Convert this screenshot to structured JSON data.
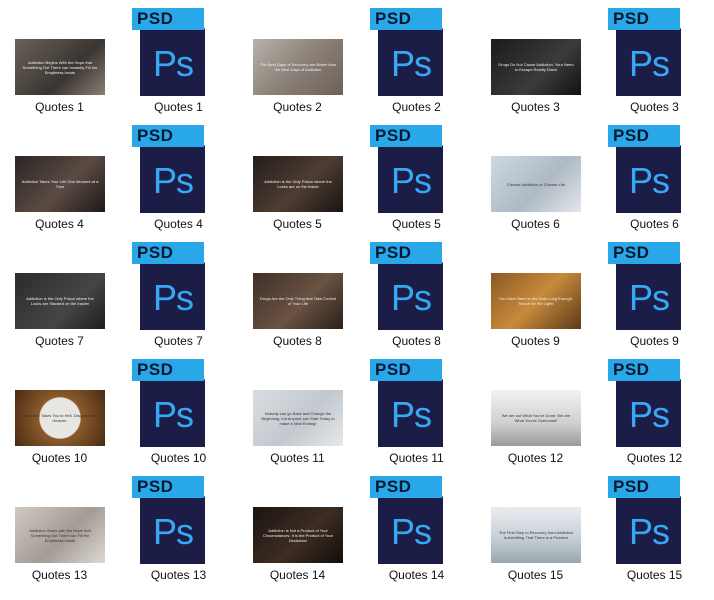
{
  "badge_text": "PSD",
  "ps_text": "Ps",
  "colors": {
    "psd_tag": "#28a8e8",
    "psd_page": "#1c1d47",
    "ps_letters": "#37a9f4"
  },
  "items": [
    {
      "label": "Quotes 1",
      "kind": "image",
      "bg": "linear-gradient(135deg,#6b625b,#3a3531 60%,#8a7f74)",
      "caption": "Addiction Begins With the Hope that Something Out There can Instantly Fill the Emptiness Inside"
    },
    {
      "label": "Quotes 1",
      "kind": "psd"
    },
    {
      "label": "Quotes 2",
      "kind": "image",
      "bg": "linear-gradient(135deg,#b9b2aa,#8b8178 50%,#6d6158)",
      "caption": "The Best Days of Recovery are Better than the Best Days of Addiction"
    },
    {
      "label": "Quotes 2",
      "kind": "psd"
    },
    {
      "label": "Quotes 3",
      "kind": "image",
      "bg": "linear-gradient(135deg,#1b1b1b,#3b3b3b 60%,#111)",
      "caption": "Drugs Do Not Cause Addiction. Your Need to Escape Reality Does!"
    },
    {
      "label": "Quotes 3",
      "kind": "psd"
    },
    {
      "label": "Quotes 4",
      "kind": "image",
      "bg": "linear-gradient(135deg,#2b2523,#5b4b44 55%,#1e1a19)",
      "caption": "Addiction Takes Your Life One Moment at a Time"
    },
    {
      "label": "Quotes 4",
      "kind": "psd"
    },
    {
      "label": "Quotes 5",
      "kind": "image",
      "bg": "linear-gradient(135deg,#241d1a,#4e3d33 55%,#1a1412)",
      "caption": "Addiction is the Only Prison where the Locks are on the Inside"
    },
    {
      "label": "Quotes 5",
      "kind": "psd"
    },
    {
      "label": "Quotes 6",
      "kind": "image",
      "light": true,
      "bg": "linear-gradient(135deg,#cfd8e0,#aeb9c4 55%,#e2e6ea)",
      "caption": "Choose Addiction or Choose Life"
    },
    {
      "label": "Quotes 6",
      "kind": "psd"
    },
    {
      "label": "Quotes 7",
      "kind": "image",
      "bg": "linear-gradient(135deg,#2b2b2b,#454545 60%,#1f1f1f)",
      "caption": "Addiction is the Only Prison where the Locks are Situated on the Inside!"
    },
    {
      "label": "Quotes 7",
      "kind": "psd"
    },
    {
      "label": "Quotes 8",
      "kind": "image",
      "bg": "linear-gradient(135deg,#3e3028,#6a5243 55%,#2a2019)",
      "caption": "Drugs Are the Only Thing that Take Control of Your Life"
    },
    {
      "label": "Quotes 8",
      "kind": "psd"
    },
    {
      "label": "Quotes 9",
      "kind": "image",
      "bg": "linear-gradient(135deg,#8a5a24,#c88a3c 50%,#5b3a18)",
      "caption": "You Have Been in the Dark Long Enough. Reach for the Light!"
    },
    {
      "label": "Quotes 9",
      "kind": "psd"
    },
    {
      "label": "Quotes 10",
      "kind": "image",
      "light": true,
      "bg": "radial-gradient(circle at 50% 50%,#e8e6e2 38%,#8a5a2c 40%,#4a2a12 100%)",
      "caption": "Addiction Takes You to Hell, Disguised as Heaven."
    },
    {
      "label": "Quotes 10",
      "kind": "psd"
    },
    {
      "label": "Quotes 11",
      "kind": "image",
      "light": true,
      "bg": "linear-gradient(135deg,#d9dde1,#c2c8ce 55%,#e6e8ea)",
      "caption": "Nobody can go Back and Change the Beginning, but Anyone can Start Today to make a New Ending!"
    },
    {
      "label": "Quotes 11",
      "kind": "psd"
    },
    {
      "label": "Quotes 12",
      "kind": "image",
      "light": true,
      "bg": "linear-gradient(180deg,#f2f2f2,#cfcfcf 60%,#9a9a9a)",
      "caption": "We are not What You've Done, We are What You've Overcome!"
    },
    {
      "label": "Quotes 12",
      "kind": "psd"
    },
    {
      "label": "Quotes 13",
      "kind": "image",
      "light": true,
      "bg": "linear-gradient(135deg,#cfc9c4,#a39b94 55%,#ded9d5)",
      "caption": "Addiction Starts with the Hope that Something Out There can Fill the Emptiness Inside"
    },
    {
      "label": "Quotes 13",
      "kind": "psd"
    },
    {
      "label": "Quotes 14",
      "kind": "image",
      "bg": "linear-gradient(135deg,#1a1410,#3d2d22 55%,#120d0a)",
      "caption": "Addiction is Not a Product of Your Circumstances, It is the Product of Your Decisions!"
    },
    {
      "label": "Quotes 14",
      "kind": "psd"
    },
    {
      "label": "Quotes 15",
      "kind": "image",
      "light": true,
      "bg": "linear-gradient(180deg,#e9edf0,#c8d0d6 55%,#9aa6ae)",
      "caption": "The First Step to Recovery from Addiction is Admitting That There is a Problem"
    },
    {
      "label": "Quotes 15",
      "kind": "psd"
    }
  ]
}
